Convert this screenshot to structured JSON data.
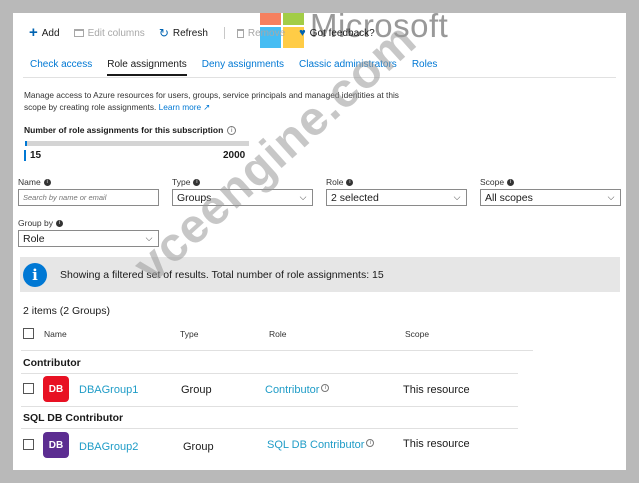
{
  "toolbar": {
    "add_label": "Add",
    "edit_columns_label": "Edit columns",
    "refresh_label": "Refresh",
    "remove_label": "Remove",
    "feedback_label": "Got feedback?"
  },
  "watermark": {
    "brand": "Microsoft",
    "site": "vceengine.com"
  },
  "tabs": [
    {
      "label": "Check access"
    },
    {
      "label": "Role assignments",
      "active": true
    },
    {
      "label": "Deny assignments"
    },
    {
      "label": "Classic administrators"
    },
    {
      "label": "Roles"
    }
  ],
  "description": {
    "line1": "Manage access to Azure resources for users, groups, service principals and managed identities at this",
    "line2": "scope by creating role assignments.",
    "learn_more": "Learn more"
  },
  "count": {
    "title": "Number of role assignments for this subscription",
    "min_label": "15",
    "max_label": "2000",
    "current": 15,
    "max": 2000
  },
  "filters": {
    "name": {
      "label": "Name",
      "placeholder": "Search by name or email"
    },
    "type": {
      "label": "Type",
      "value": "Groups"
    },
    "role": {
      "label": "Role",
      "value": "2 selected"
    },
    "scope": {
      "label": "Scope",
      "value": "All scopes"
    },
    "group_by": {
      "label": "Group by",
      "value": "Role"
    }
  },
  "banner": {
    "icon": "info-icon",
    "text": "Showing a filtered set of results. Total number of role assignments: 15"
  },
  "list": {
    "summary": "2 items (2 Groups)",
    "columns": {
      "name": "Name",
      "type": "Type",
      "role": "Role",
      "scope": "Scope"
    },
    "groups": [
      {
        "title": "Contributor",
        "rows": [
          {
            "initials": "DB",
            "avatar_color": "#e81123",
            "name": "DBAGroup1",
            "type": "Group",
            "role": "Contributor",
            "scope": "This resource"
          }
        ]
      },
      {
        "title": "SQL DB Contributor",
        "rows": [
          {
            "initials": "DB",
            "avatar_color": "#5c2d91",
            "name": "DBAGroup2",
            "type": "Group",
            "role": "SQL DB Contributor",
            "scope": "This resource"
          }
        ]
      }
    ]
  },
  "colors": {
    "accent": "#0078d4",
    "link": "#1f9cc7",
    "banner_bg": "#e6e6e6"
  }
}
